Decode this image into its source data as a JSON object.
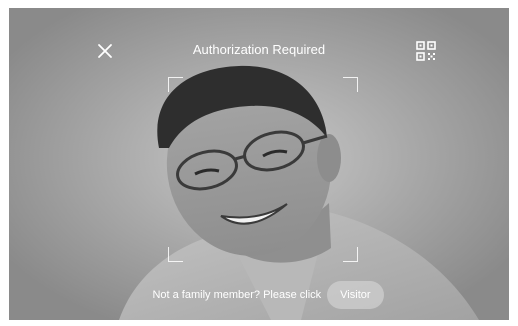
{
  "header": {
    "title": "Authorization Required"
  },
  "icons": {
    "close": "close-icon",
    "qr": "qr-code-icon"
  },
  "footer": {
    "prompt": "Not a family member? Please click",
    "visitor_label": "Visitor"
  },
  "colors": {
    "overlay_text": "#ffffff",
    "background_gray": "#8c8c8c",
    "button_fill": "#dcdcdc"
  }
}
